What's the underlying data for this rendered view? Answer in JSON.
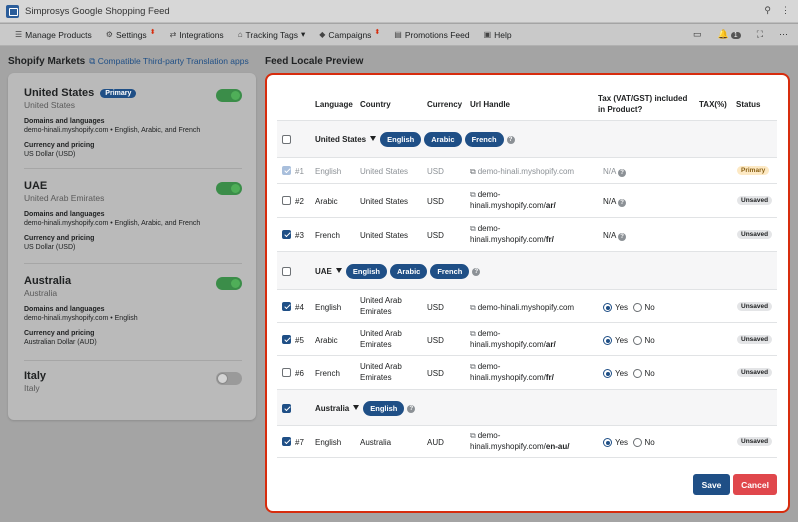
{
  "titlebar": {
    "title": "Simprosys Google Shopping Feed"
  },
  "menu": [
    {
      "label": "Manage Products",
      "icon": "list-icon"
    },
    {
      "label": "Settings",
      "icon": "gear-icon",
      "caret": true
    },
    {
      "label": "Integrations",
      "icon": "integrations-icon"
    },
    {
      "label": "Tracking Tags",
      "icon": "tag-icon",
      "dropdown": true
    },
    {
      "label": "Campaigns",
      "icon": "campaign-icon",
      "caret": true
    },
    {
      "label": "Promotions Feed",
      "icon": "document-icon"
    },
    {
      "label": "Help",
      "icon": "chat-icon"
    }
  ],
  "notifications": {
    "count": "1"
  },
  "left": {
    "title": "Shopify Markets",
    "link": "Compatible Third-party Translation apps",
    "domains_label": "Domains and languages",
    "currency_label": "Currency and pricing",
    "markets": [
      {
        "name": "United States",
        "badge": "Primary",
        "sub": "United States",
        "domains": "demo-hinali.myshopify.com • English, Arabic, and French",
        "currency": "US Dollar (USD)",
        "enabled": true
      },
      {
        "name": "UAE",
        "sub": "United Arab Emirates",
        "domains": "demo-hinali.myshopify.com • English, Arabic, and French",
        "currency": "US Dollar (USD)",
        "enabled": true
      },
      {
        "name": "Australia",
        "sub": "Australia",
        "domains": "demo-hinali.myshopify.com • English",
        "currency": "Australian Dollar (AUD)",
        "enabled": true
      },
      {
        "name": "Italy",
        "sub": "Italy",
        "enabled": false
      }
    ]
  },
  "preview": {
    "title": "Feed Locale Preview",
    "headers": {
      "language": "Language",
      "country": "Country",
      "currency": "Currency",
      "url": "Url Handle",
      "tax": "Tax (VAT/GST) included in Product?",
      "tax_pct": "TAX(%)",
      "status": "Status"
    },
    "groups": {
      "us": {
        "name": "United States",
        "langs": [
          "English",
          "Arabic",
          "French"
        ]
      },
      "uae": {
        "name": "UAE",
        "langs": [
          "English",
          "Arabic",
          "French"
        ]
      },
      "au": {
        "name": "Australia",
        "langs": [
          "English"
        ]
      }
    },
    "rows": [
      {
        "num": "#1",
        "lang": "English",
        "country": "United States",
        "cur": "USD",
        "url": "demo-hinali.myshopify.com",
        "tax": "N/A",
        "status": "Primary"
      },
      {
        "num": "#2",
        "lang": "Arabic",
        "country": "United States",
        "cur": "USD",
        "url1": "demo-",
        "url2a": "hinali.myshopify.com/",
        "url2b": "ar/",
        "tax": "N/A",
        "status": "Unsaved"
      },
      {
        "num": "#3",
        "lang": "French",
        "country": "United States",
        "cur": "USD",
        "url1": "demo-",
        "url2a": "hinali.myshopify.com/",
        "url2b": "fr/",
        "tax": "N/A",
        "status": "Unsaved"
      },
      {
        "num": "#4",
        "lang": "English",
        "country1": "United Arab",
        "country2": "Emirates",
        "cur": "USD",
        "url": "demo-hinali.myshopify.com",
        "yes": "Yes",
        "no": "No",
        "status": "Unsaved"
      },
      {
        "num": "#5",
        "lang": "Arabic",
        "country1": "United Arab",
        "country2": "Emirates",
        "cur": "USD",
        "url1": "demo-",
        "url2a": "hinali.myshopify.com/",
        "url2b": "ar/",
        "yes": "Yes",
        "no": "No",
        "status": "Unsaved"
      },
      {
        "num": "#6",
        "lang": "French",
        "country1": "United Arab",
        "country2": "Emirates",
        "cur": "USD",
        "url1": "demo-",
        "url2a": "hinali.myshopify.com/",
        "url2b": "fr/",
        "yes": "Yes",
        "no": "No",
        "status": "Unsaved"
      },
      {
        "num": "#7",
        "lang": "English",
        "country": "Australia",
        "cur": "AUD",
        "url1": "demo-",
        "url2a": "hinali.myshopify.com/",
        "url2b": "en-au/",
        "yes": "Yes",
        "no": "No",
        "status": "Unsaved"
      }
    ],
    "save_label": "Save",
    "cancel_label": "Cancel"
  }
}
